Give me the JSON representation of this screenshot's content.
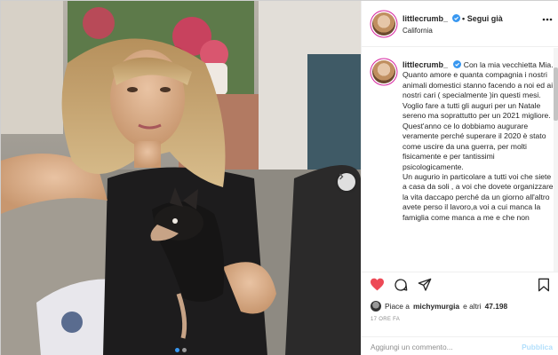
{
  "colors": {
    "accent": "#3897f0",
    "like_red": "#ed4956",
    "text": "#262626",
    "muted": "#8e8e8e"
  },
  "post": {
    "username": "littlecrumb_",
    "follow_separator": "•",
    "follow_label": "Segui già",
    "location": "California",
    "caption": "Con la mia vecchietta Mia.\nQuanto amore e quanta compagnia i nostri animali domestici stanno facendo a noi ed ai nostri cari ( specialmente )in questi mesi.\nVoglio fare a tutti gli auguri per un Natale sereno ma soprattutto per un 2021 migliore.\nQuest'anno ce lo dobbiamo augurare veramente perché superare il 2020 è stato come uscire da una guerra, per molti fisicamente e per tantissimi psicologicamente.\nUn augurio in particolare a tutti voi che siete a casa da soli , a voi che dovete organizzare la vita daccapo perché da un giorno all'altro avete perso il lavoro,a voi a cui manca la famiglia come manca a me e che non",
    "liked_by_prefix": "Piace a",
    "liked_by_user": "michymurgia",
    "liked_by_and": "e altri",
    "likes_count": "47.198",
    "timestamp": "17 ORE FA",
    "comment_placeholder": "Aggiungi un commento...",
    "publish_label": "Pubblica"
  },
  "icons": {
    "verified": "verified-badge-icon",
    "more": "more-options-icon",
    "like": "heart-icon",
    "comment": "comment-icon",
    "share": "share-icon",
    "save": "bookmark-icon",
    "next": "chevron-right-icon"
  },
  "carousel": {
    "slides": 2,
    "current": 1
  }
}
